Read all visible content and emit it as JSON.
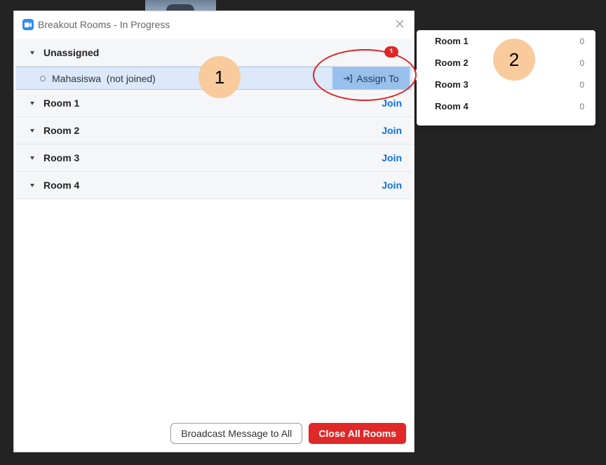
{
  "dialog": {
    "title": "Breakout Rooms - In Progress",
    "app_icon": "zoom-camera-icon",
    "close_icon": "close-icon"
  },
  "unassigned": {
    "label": "Unassigned",
    "badge": "1",
    "participant": {
      "name": "Mahasiswa  (not joined)",
      "assign_label": "Assign To",
      "assign_icon": "assign-arrow-icon"
    }
  },
  "rooms": [
    {
      "name": "Room 1",
      "action": "Join"
    },
    {
      "name": "Room 2",
      "action": "Join"
    },
    {
      "name": "Room 3",
      "action": "Join"
    },
    {
      "name": "Room 4",
      "action": "Join"
    }
  ],
  "footer": {
    "broadcast_label": "Broadcast Message to All",
    "close_all_label": "Close All Rooms"
  },
  "assign_popup": {
    "items": [
      {
        "name": "Room 1",
        "count": "0"
      },
      {
        "name": "Room 2",
        "count": "0"
      },
      {
        "name": "Room 3",
        "count": "0"
      },
      {
        "name": "Room 4",
        "count": "0"
      }
    ]
  },
  "annotations": {
    "step1": "1",
    "step2": "2"
  },
  "colors": {
    "accent_blue": "#0e71eb",
    "danger_red": "#e02828",
    "selected_row": "#dbe9fb",
    "annotation_badge": "#f9cb9c"
  }
}
